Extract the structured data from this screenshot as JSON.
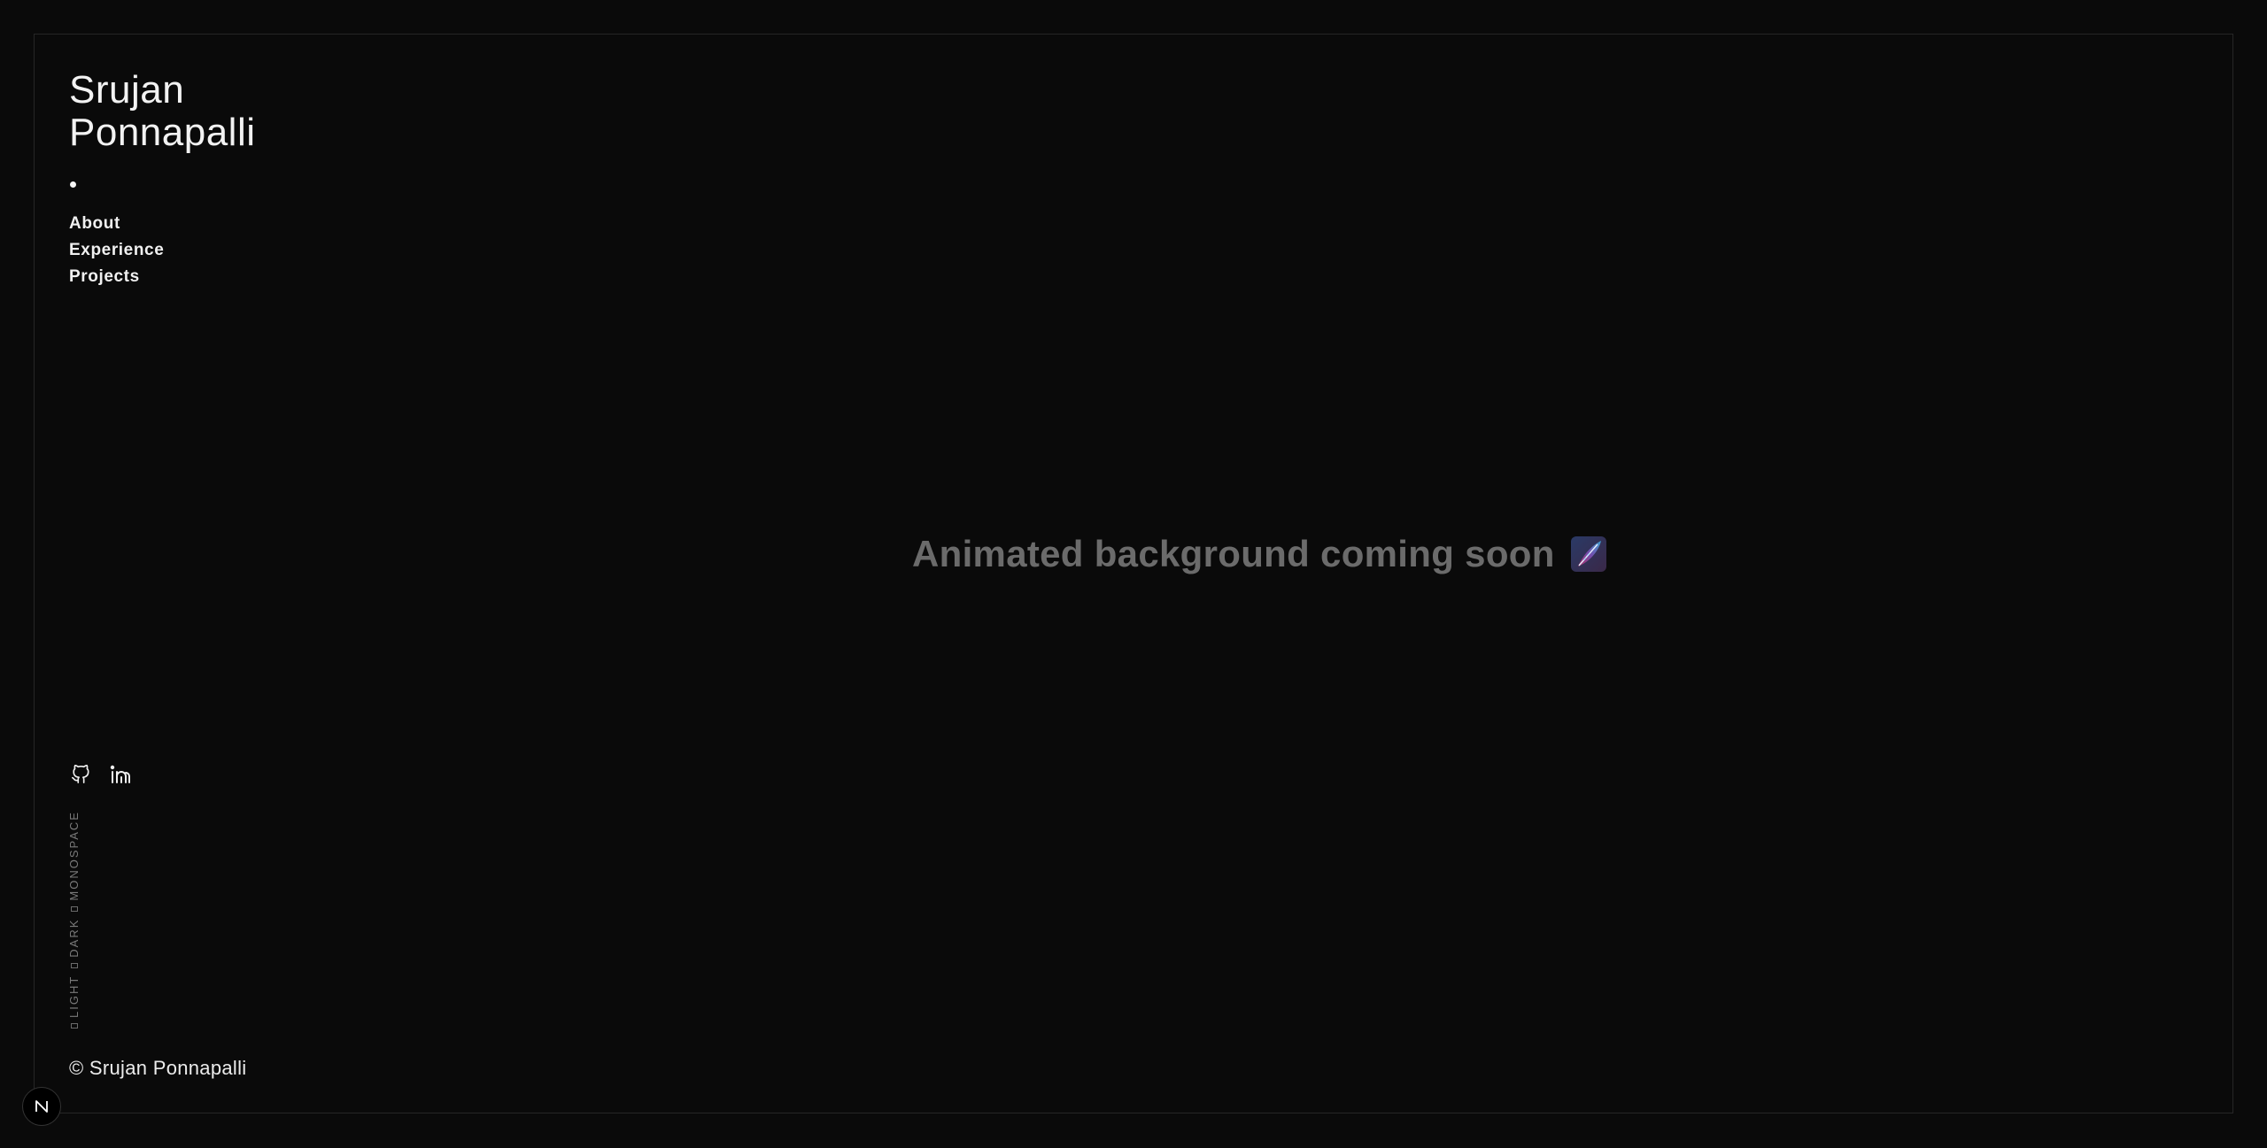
{
  "sidebar": {
    "name_line1": "Srujan",
    "name_line2": "Ponnapalli",
    "nav": [
      {
        "label": "About"
      },
      {
        "label": "Experience"
      },
      {
        "label": "Projects"
      }
    ],
    "socials": [
      {
        "icon": "github-icon"
      },
      {
        "icon": "linkedin-icon"
      }
    ],
    "theme_options": [
      "LIGHT",
      "DARK",
      "MONOSPACE"
    ],
    "copyright": "© Srujan Ponnapalli"
  },
  "main": {
    "message": "Animated background coming soon",
    "emoji": "feather-emoji-icon"
  },
  "dev_badge": {
    "label": "N"
  },
  "colors": {
    "background": "#0a0a0a",
    "border": "#262626",
    "text": "#ededed",
    "muted": "#6b6b6b"
  }
}
